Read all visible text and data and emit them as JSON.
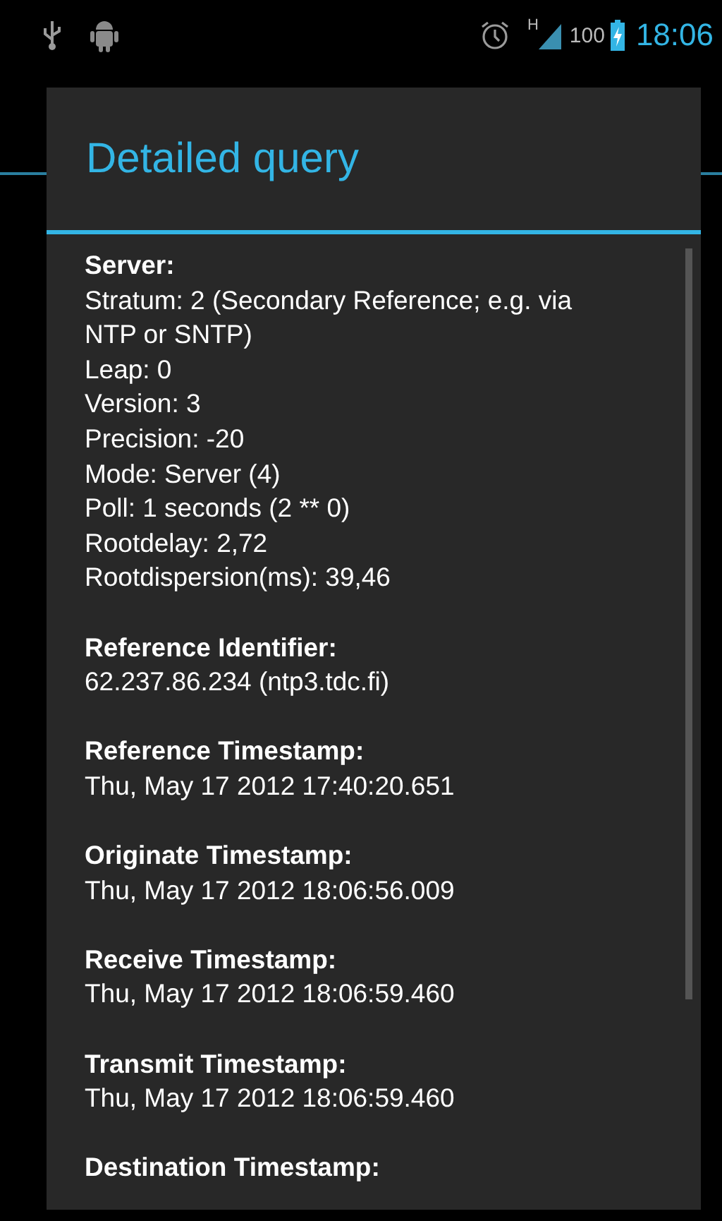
{
  "status_bar": {
    "network_label": "H",
    "battery_percent": "100",
    "time": "18:06"
  },
  "dialog": {
    "title": "Detailed query",
    "sections": [
      {
        "heading": "Server:",
        "lines": [
          "Stratum: 2 (Secondary Reference; e.g. via NTP or SNTP)",
          "Leap: 0",
          "Version: 3",
          "Precision: -20",
          "Mode: Server (4)",
          "Poll: 1 seconds (2 ** 0)",
          "Rootdelay: 2,72",
          "Rootdispersion(ms): 39,46"
        ]
      },
      {
        "heading": "Reference Identifier:",
        "lines": [
          "62.237.86.234 (ntp3.tdc.fi)"
        ]
      },
      {
        "heading": "Reference Timestamp:",
        "lines": [
          "Thu, May 17 2012 17:40:20.651"
        ]
      },
      {
        "heading": "Originate Timestamp:",
        "lines": [
          "Thu, May 17 2012 18:06:56.009"
        ]
      },
      {
        "heading": "Receive Timestamp:",
        "lines": [
          "Thu, May 17 2012 18:06:59.460"
        ]
      },
      {
        "heading": "Transmit Timestamp:",
        "lines": [
          "Thu, May 17 2012 18:06:59.460"
        ]
      },
      {
        "heading": "Destination Timestamp:"
      }
    ]
  }
}
